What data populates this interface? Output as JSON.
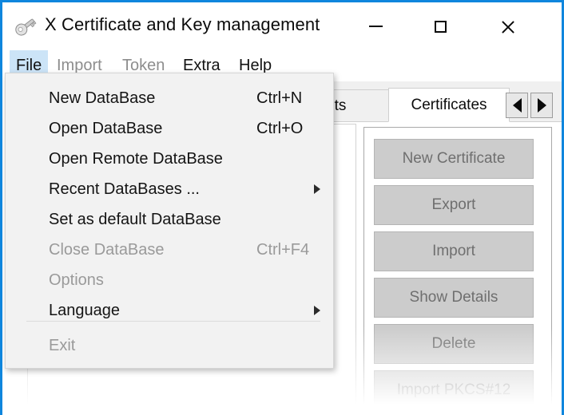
{
  "window": {
    "title": "X Certificate and Key management",
    "icon": "key-icon",
    "border_color": "#0f86dd",
    "controls": {
      "minimize": "–",
      "maximize": "□",
      "close": "×"
    }
  },
  "menubar": {
    "items": [
      {
        "label": "File",
        "enabled": true,
        "open": true
      },
      {
        "label": "Import",
        "enabled": false,
        "open": false
      },
      {
        "label": "Token",
        "enabled": false,
        "open": false
      },
      {
        "label": "Extra",
        "enabled": true,
        "open": false
      },
      {
        "label": "Help",
        "enabled": true,
        "open": false
      }
    ]
  },
  "file_menu": {
    "items": [
      {
        "label": "New DataBase",
        "shortcut": "Ctrl+N",
        "enabled": true,
        "submenu": false
      },
      {
        "label": "Open DataBase",
        "shortcut": "Ctrl+O",
        "enabled": true,
        "submenu": false
      },
      {
        "label": "Open Remote DataBase",
        "shortcut": "",
        "enabled": true,
        "submenu": false
      },
      {
        "label": "Recent DataBases ...",
        "shortcut": "",
        "enabled": true,
        "submenu": true
      },
      {
        "label": "Set as default DataBase",
        "shortcut": "",
        "enabled": true,
        "submenu": false
      },
      {
        "label": "Close DataBase",
        "shortcut": "Ctrl+F4",
        "enabled": false,
        "submenu": false
      },
      {
        "label": "Options",
        "shortcut": "",
        "enabled": false,
        "submenu": false
      },
      {
        "label": "Language",
        "shortcut": "",
        "enabled": true,
        "submenu": true
      },
      {
        "label": "Exit",
        "shortcut": "",
        "enabled": false,
        "submenu": false
      }
    ]
  },
  "tabs": {
    "items": [
      {
        "label": "ests",
        "selected": false
      },
      {
        "label": "Certificates",
        "selected": true
      }
    ],
    "scroll_left": "◀",
    "scroll_right": "▶"
  },
  "side_buttons": [
    {
      "label": "New Certificate",
      "enabled": false
    },
    {
      "label": "Export",
      "enabled": false
    },
    {
      "label": "Import",
      "enabled": false
    },
    {
      "label": "Show Details",
      "enabled": false
    },
    {
      "label": "Delete",
      "enabled": false
    },
    {
      "label": "Import PKCS#12",
      "enabled": false
    }
  ]
}
